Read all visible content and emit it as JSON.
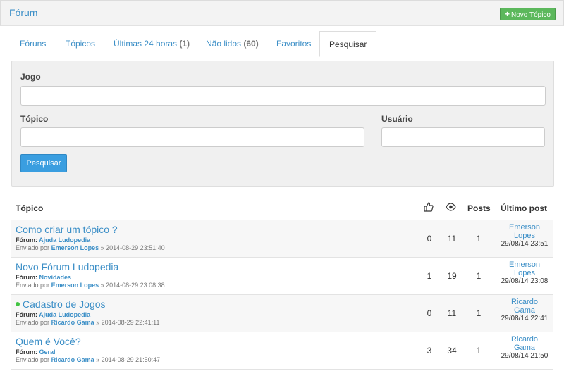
{
  "header": {
    "title": "Fórum",
    "new_topic_label": "Novo Tópico"
  },
  "tabs": [
    {
      "label": "Fóruns"
    },
    {
      "label": "Tópicos"
    },
    {
      "label": "Últimas 24 horas",
      "count": "(1)"
    },
    {
      "label": "Não lidos",
      "count": "(60)"
    },
    {
      "label": "Favoritos"
    },
    {
      "label": "Pesquisar"
    }
  ],
  "search": {
    "game_label": "Jogo",
    "game_value": "",
    "topic_label": "Tópico",
    "topic_value": "",
    "user_label": "Usuário",
    "user_value": "",
    "button_label": "Pesquisar"
  },
  "table": {
    "headers": {
      "topic": "Tópico",
      "posts": "Posts",
      "last_post": "Último post",
      "likes_icon": "thumbs-up-icon",
      "views_icon": "eye-icon"
    },
    "forum_prefix": "Fórum:",
    "sent_prefix": "Enviado por",
    "rows": [
      {
        "title": "Como criar um tópico ?",
        "forum": "Ajuda Ludopedia",
        "author": "Emerson Lopes",
        "date": "» 2014-08-29 23:51:40",
        "likes": "0",
        "views": "11",
        "posts": "1",
        "last_user": "Emerson Lopes",
        "last_date": "29/08/14 23:51",
        "unread": false
      },
      {
        "title": "Novo Fórum Ludopedia",
        "forum": "Novidades",
        "author": "Emerson Lopes",
        "date": "» 2014-08-29 23:08:38",
        "likes": "1",
        "views": "19",
        "posts": "1",
        "last_user": "Emerson Lopes",
        "last_date": "29/08/14 23:08",
        "unread": false
      },
      {
        "title": "Cadastro de Jogos",
        "forum": "Ajuda Ludopedia",
        "author": "Ricardo Gama",
        "date": "» 2014-08-29 22:41:11",
        "likes": "0",
        "views": "11",
        "posts": "1",
        "last_user": "Ricardo Gama",
        "last_date": "29/08/14 22:41",
        "unread": true
      },
      {
        "title": "Quem é Você?",
        "forum": "Geral",
        "author": "Ricardo Gama",
        "date": "» 2014-08-29 21:50:47",
        "likes": "3",
        "views": "34",
        "posts": "1",
        "last_user": "Ricardo Gama",
        "last_date": "29/08/14 21:50",
        "unread": false
      }
    ]
  },
  "colors": {
    "link": "#3c8fc7",
    "new_topic_button": "#5cb85c",
    "search_button": "#3a9ee0",
    "unread_dot": "#42c443"
  }
}
